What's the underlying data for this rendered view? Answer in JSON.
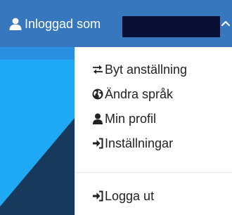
{
  "header": {
    "logged_in_label": "Inloggad som",
    "user_icon": "user-icon",
    "toggle_icon": "chevron-up-icon",
    "background_color": "#3677bd"
  },
  "menu": {
    "items": [
      {
        "label": "Byt anställning",
        "icon": "exchange-icon"
      },
      {
        "label": "Ändra språk",
        "icon": "globe-icon"
      },
      {
        "label": "Min profil",
        "icon": "user-icon"
      },
      {
        "label": "Inställningar",
        "icon": "sign-in-icon"
      }
    ],
    "logout": {
      "label": "Logga ut",
      "icon": "sign-in-icon"
    }
  },
  "colors": {
    "header_blue": "#3677bd",
    "page_band_blue": "#2a8fe0",
    "page_sky_blue": "#1fa8f3",
    "page_navy": "#173a5c",
    "redaction": "#0a1034"
  }
}
